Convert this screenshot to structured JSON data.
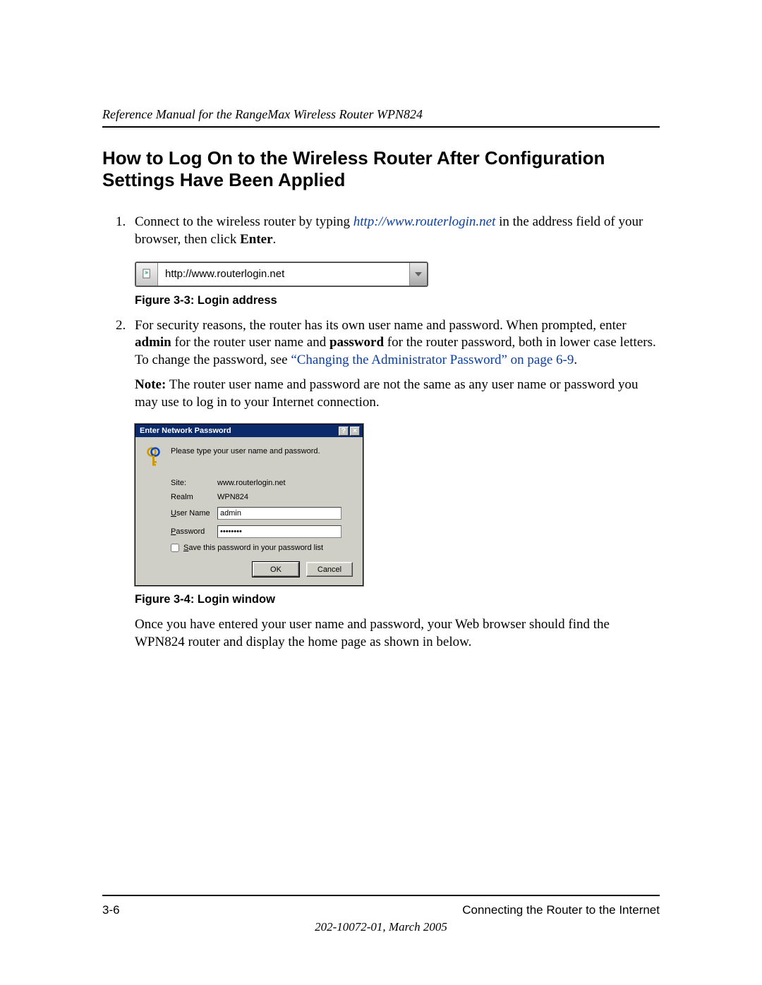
{
  "header": {
    "running_title": "Reference Manual for the RangeMax Wireless Router WPN824"
  },
  "section": {
    "title": "How to Log On to the Wireless Router After Configuration Settings Have Been Applied"
  },
  "steps": [
    {
      "pre": "Connect to the wireless router by typing ",
      "link_text": "http://www.routerlogin.net",
      "post": " in the address field of your browser, then click ",
      "bold_end": "Enter",
      "tail": "."
    },
    {
      "pre": "For security reasons, the router has its own user name and password. When prompted, enter ",
      "bold1": "admin",
      "mid1": " for the router user name and ",
      "bold2": "password",
      "mid2": " for the router password, both in lower case letters. To change the password, see ",
      "xref": "“Changing the Administrator Password” on page 6-9",
      "tail": ".",
      "note_label": "Note:",
      "note_text": " The router user name and password are not the same as any user name or password you may use to log in to your Internet connection."
    }
  ],
  "figure3": {
    "url": "http://www.routerlogin.net",
    "caption": "Figure 3-3:  Login address"
  },
  "figure4": {
    "caption": "Figure 3-4:  Login window",
    "dialog": {
      "title": "Enter Network Password",
      "help_btn": "?",
      "close_btn": "×",
      "prompt": "Please type your user name and password.",
      "site_label": "Site:",
      "site_value": "www.routerlogin.net",
      "realm_label": "Realm",
      "realm_value": "WPN824",
      "username_label_pre": "U",
      "username_label_rest": "ser Name",
      "username_value": "admin",
      "password_label_pre": "P",
      "password_label_rest": "assword",
      "password_value": "••••••••",
      "save_pre": "S",
      "save_rest": "ave this password in your password list",
      "ok": "OK",
      "cancel": "Cancel"
    }
  },
  "after_figure": "Once you have entered your user name and password, your Web browser should find the WPN824 router and display the home page as shown in below.",
  "footer": {
    "page_num": "3-6",
    "chapter": "Connecting the Router to the Internet",
    "docinfo": "202-10072-01, March 2005"
  }
}
